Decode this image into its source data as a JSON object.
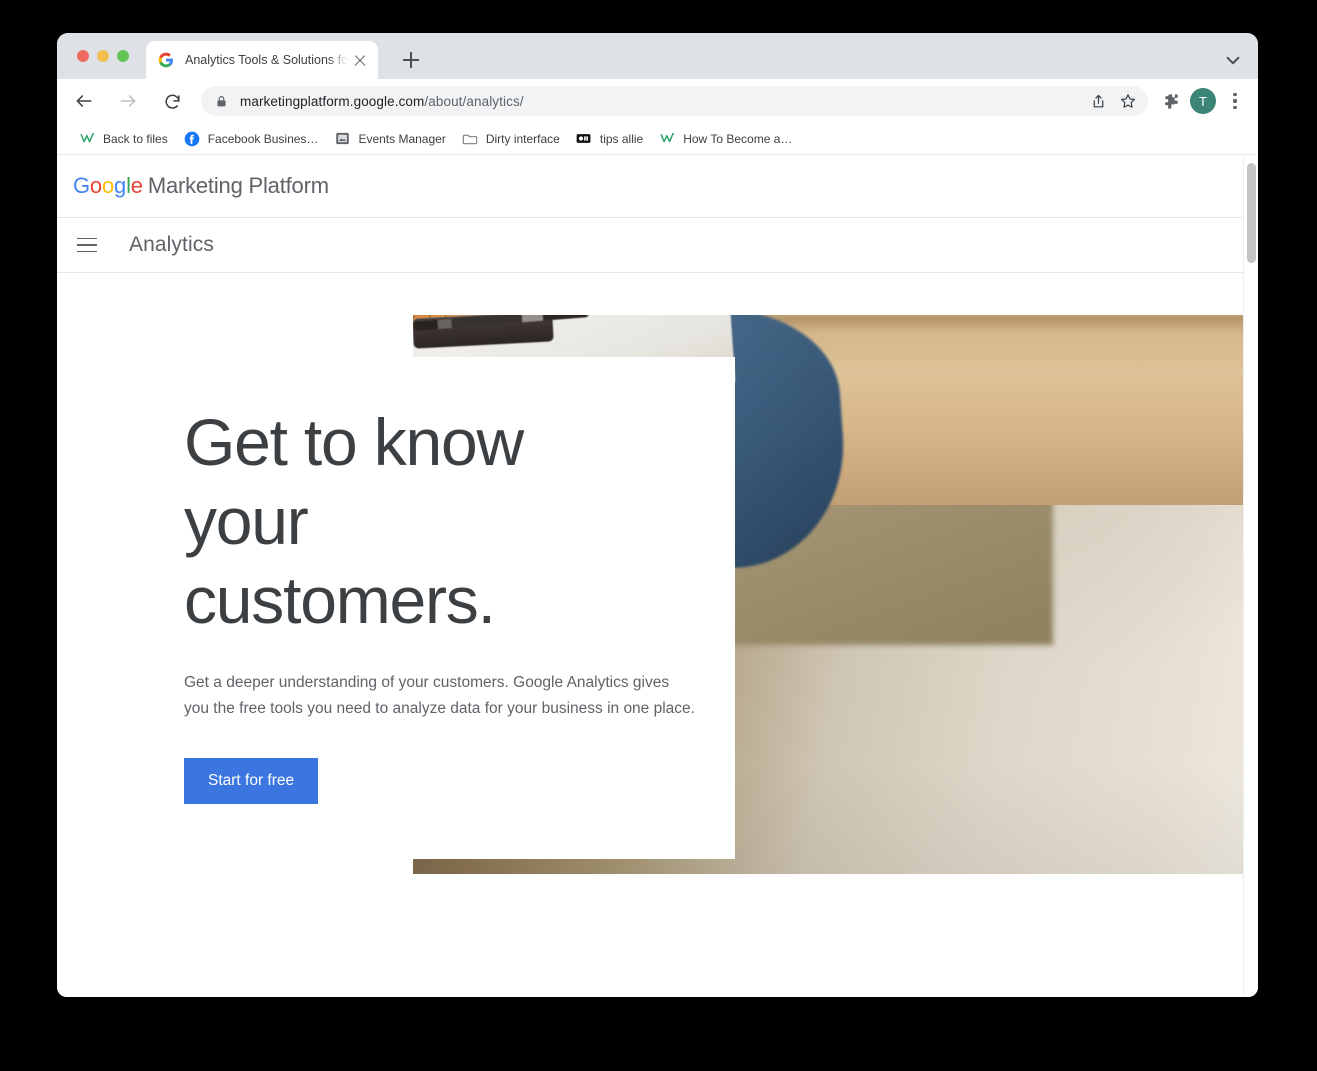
{
  "window": {
    "traffic_lights": [
      "close",
      "minimize",
      "zoom"
    ],
    "colors": {
      "close": "#ec6a5f",
      "minimize": "#f4bf50",
      "zoom": "#61c454"
    }
  },
  "tabstrip": {
    "tabs": [
      {
        "title": "Analytics Tools & Solutions for",
        "favicon": "google-favicon",
        "active": true
      }
    ],
    "new_tab_label": "+",
    "tab_list_chevron": "chevron-down-icon"
  },
  "toolbar": {
    "back": "back-arrow-icon",
    "forward": "forward-arrow-icon",
    "reload": "reload-icon",
    "lock": "lock-icon",
    "url_domain": "marketingplatform.google.com",
    "url_path": "/about/analytics/",
    "share": "share-icon",
    "bookmark": "star-icon",
    "extensions": "puzzle-piece-icon",
    "profile_initial": "T",
    "profile_color": "#3c8576",
    "menu": "kebab-menu-icon"
  },
  "bookmarks": {
    "items": [
      {
        "label": "Back to files",
        "icon": "wrike-icon"
      },
      {
        "label": "Facebook Busines…",
        "icon": "facebook-icon"
      },
      {
        "label": "Events Manager",
        "icon": "events-manager-icon"
      },
      {
        "label": "Dirty interface",
        "icon": "folder-icon"
      },
      {
        "label": "tips allie",
        "icon": "tips-allie-icon"
      },
      {
        "label": "How To Become a…",
        "icon": "wrike-icon"
      }
    ]
  },
  "page": {
    "brand": {
      "google": [
        {
          "char": "G",
          "color": "#4285f4"
        },
        {
          "char": "o",
          "color": "#ea4335"
        },
        {
          "char": "o",
          "color": "#fbbc05"
        },
        {
          "char": "g",
          "color": "#4285f4"
        },
        {
          "char": "l",
          "color": "#34a853"
        },
        {
          "char": "e",
          "color": "#ea4335"
        }
      ],
      "suffix": "Marketing Platform"
    },
    "product_bar": {
      "menu_icon": "hamburger-menu-icon",
      "product_name": "Analytics"
    },
    "hero": {
      "heading": "Get to know your customers.",
      "subheading": "Get a deeper understanding of your customers. Google Analytics gives you the free tools you need to analyze data for your business in one place.",
      "cta_label": "Start for free",
      "cta_color": "#3b76e0",
      "image_alt": "Woman in denim shirt and apron leaning on a wooden workbench in a flower shop"
    }
  },
  "scrollbar": {
    "position": "right",
    "thumb_color": "#c4c4c4"
  }
}
